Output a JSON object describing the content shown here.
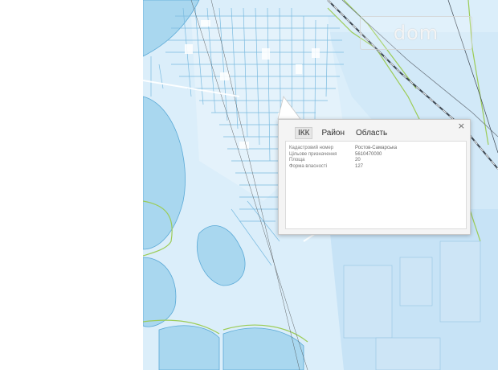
{
  "watermark": {
    "text": "dom"
  },
  "popup": {
    "close_glyph": "×",
    "tabs": [
      {
        "label": "ІКК",
        "active": true
      },
      {
        "label": "Район",
        "active": false
      },
      {
        "label": "Область",
        "active": false
      }
    ],
    "rows": [
      {
        "key": "Кадастровий номер",
        "value": "Ростов-Самарська"
      },
      {
        "key": "Цільове призначення",
        "value": "5610470000"
      },
      {
        "key": "Площа",
        "value": "20"
      },
      {
        "key": "Форма власності",
        "value": "127"
      }
    ]
  },
  "colors": {
    "map_background": "#dbeefa",
    "water": "#a9d7ef",
    "parcel_stroke": "#7bbbe0",
    "boundary_green": "#9ccc57",
    "railway": "#3d4650"
  }
}
